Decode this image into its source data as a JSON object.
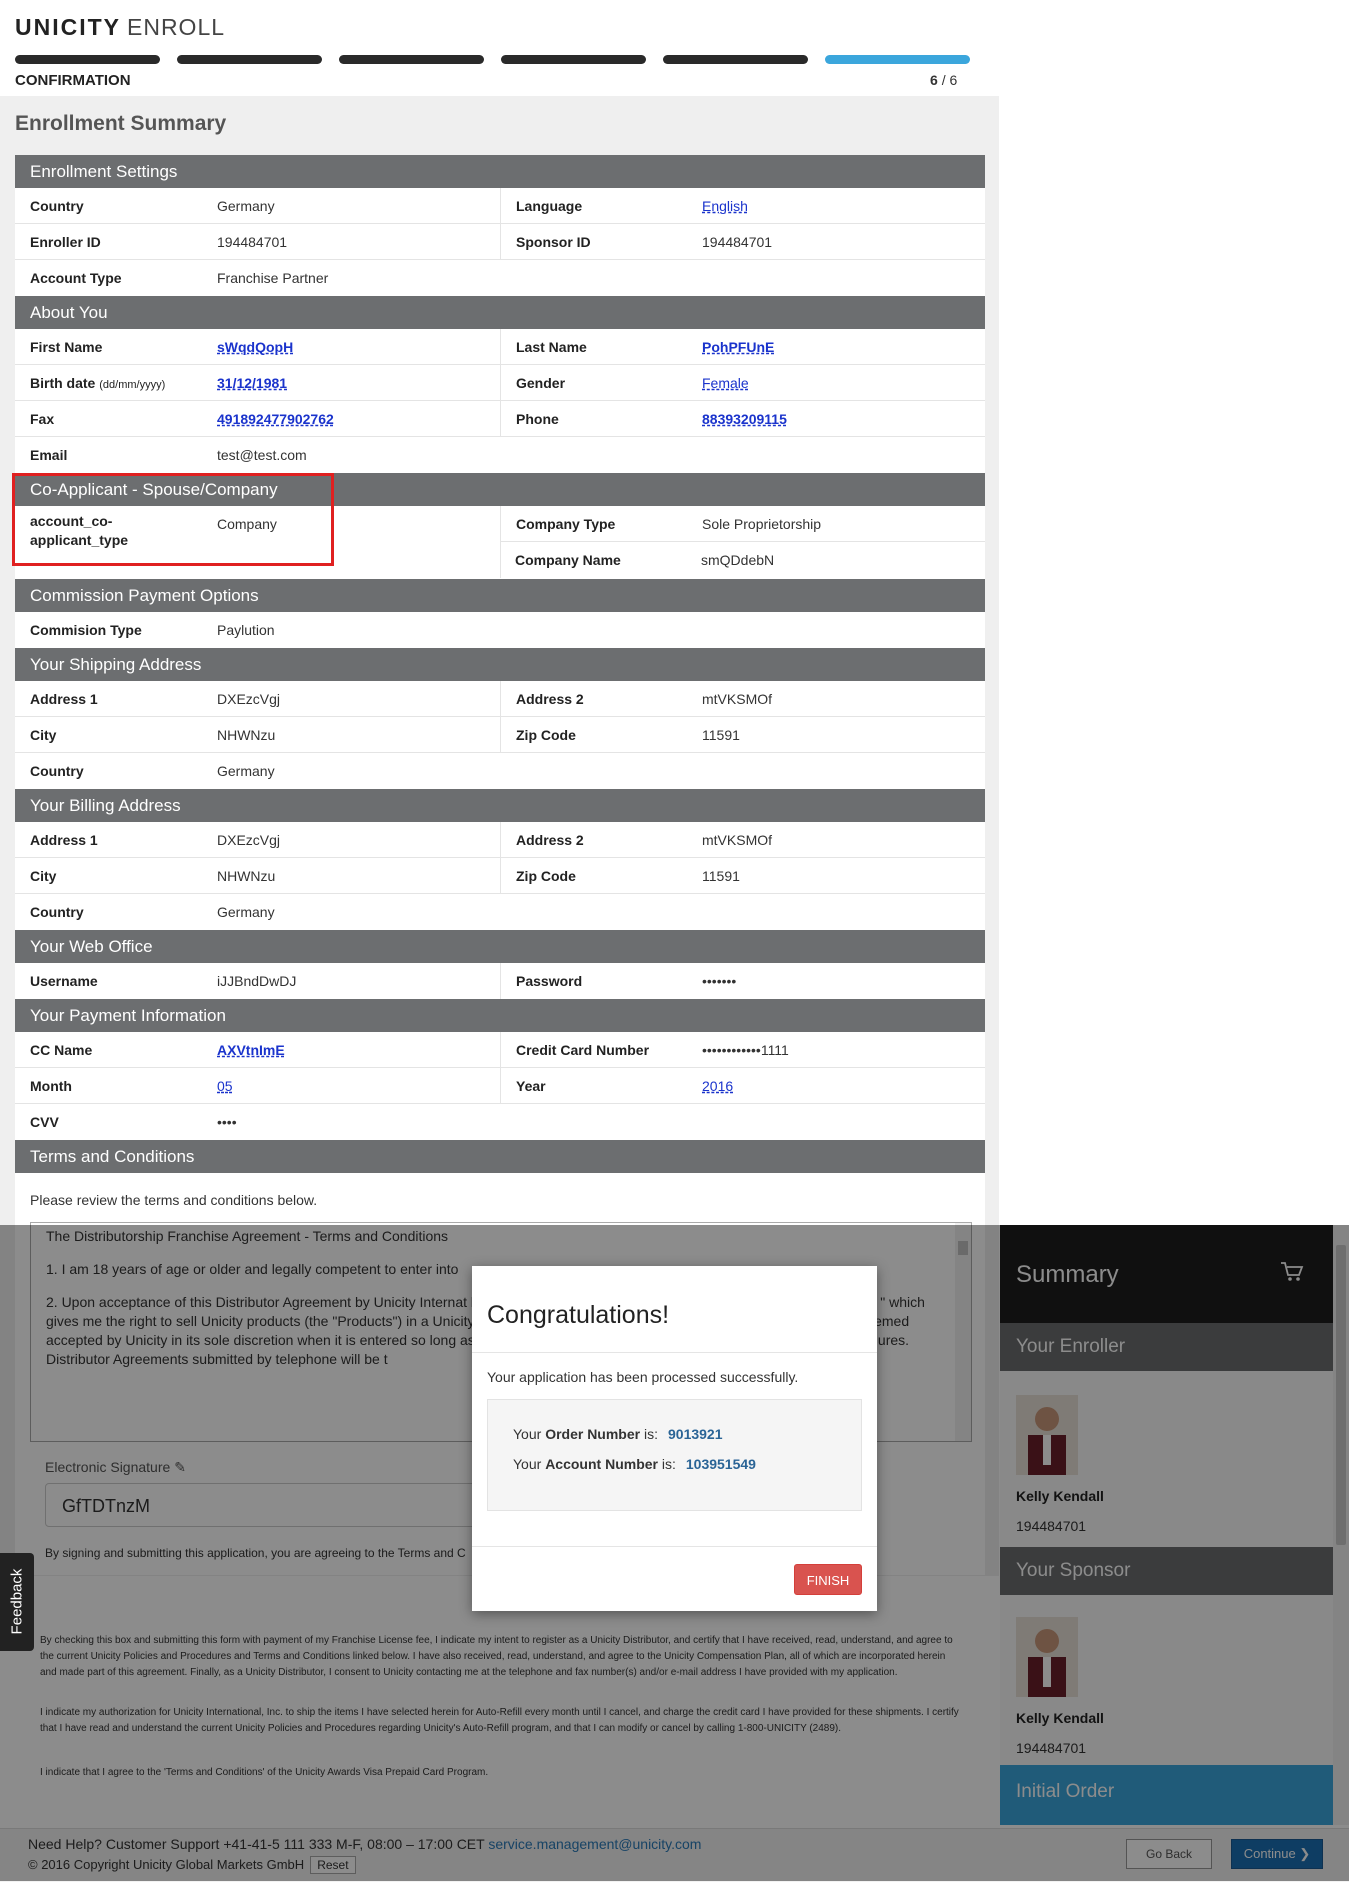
{
  "header": {
    "brand": "UNICITY",
    "product": "ENROLL",
    "step_label": "CONFIRMATION",
    "step_current": "6",
    "step_total": "/ 6",
    "progress": {
      "steps_total": 6,
      "current": 6
    }
  },
  "page_title": "Enrollment Summary",
  "sections": {
    "enrollment_settings": {
      "title": "Enrollment Settings",
      "country_label": "Country",
      "country": "Germany",
      "language_label": "Language",
      "language": "English",
      "enroller_label": "Enroller ID",
      "enroller": "194484701",
      "sponsor_label": "Sponsor ID",
      "sponsor": "194484701",
      "account_type_label": "Account Type",
      "account_type": "Franchise Partner"
    },
    "about_you": {
      "title": "About You",
      "first_name_label": "First Name",
      "first_name": "sWqdQopH",
      "last_name_label": "Last Name",
      "last_name": "PohPFUnE",
      "birth_label": "Birth date",
      "birth_hint": "(dd/mm/yyyy)",
      "birth": "31/12/1981",
      "gender_label": "Gender",
      "gender": "Female",
      "fax_label": "Fax",
      "fax": "491892477902762",
      "phone_label": "Phone",
      "phone": "88393209115",
      "email_label": "Email",
      "email": "test@test.com"
    },
    "co_applicant": {
      "title": "Co-Applicant - Spouse/Company",
      "type_label_1": "account_co-",
      "type_label_2": "applicant_type",
      "type": "Company",
      "company_type_label": "Company Type",
      "company_type": "Sole Proprietorship",
      "company_name_label": "Company Name",
      "company_name": "smQDdebN"
    },
    "commission": {
      "title": "Commission Payment Options",
      "type_label": "Commision Type",
      "type": "Paylution"
    },
    "shipping": {
      "title": "Your Shipping Address",
      "address1_label": "Address 1",
      "address1": "DXEzcVgj",
      "address2_label": "Address 2",
      "address2": "mtVKSMOf",
      "city_label": "City",
      "city": "NHWNzu",
      "zip_label": "Zip Code",
      "zip": "11591",
      "country_label": "Country",
      "country": "Germany"
    },
    "billing": {
      "title": "Your Billing Address",
      "address1_label": "Address 1",
      "address1": "DXEzcVgj",
      "address2_label": "Address 2",
      "address2": "mtVKSMOf",
      "city_label": "City",
      "city": "NHWNzu",
      "zip_label": "Zip Code",
      "zip": "11591",
      "country_label": "Country",
      "country": "Germany"
    },
    "web_office": {
      "title": "Your Web Office",
      "username_label": "Username",
      "username": "iJJBndDwDJ",
      "password_label": "Password",
      "password": "•••••••"
    },
    "payment": {
      "title": "Your Payment Information",
      "cc_name_label": "CC Name",
      "cc_name": "AXVtnImE",
      "cc_number_label": "Credit Card Number",
      "cc_number": "••••••••••••1111",
      "month_label": "Month",
      "month": "05",
      "year_label": "Year",
      "year": "2016",
      "cvv_label": "CVV",
      "cvv": "••••"
    },
    "terms": {
      "title": "Terms and Conditions",
      "intro": "Please review the terms and conditions below.",
      "p1": "The Distributorship Franchise Agreement - Terms and Conditions",
      "p2": "1. I am 18 years of age or older and legally competent to enter into",
      "p3": "2. Upon acceptance of this Distributor Agreement by Unicity Internat be an independent contractor and licensed distributor (hereinafter \" which gives me the right to sell Unicity products (the \"Products\") in a Unicity Compensation Plan (the \"Compensation Plan\"). This Distribu deemed accepted by Unicity in its sole discretion when it is entered so long as there have been no violations with respect to this applica Procedures. Distributor Agreements submitted by telephone will be t",
      "esig_label": "Electronic Signature",
      "esig_value": "GfTDTnzM",
      "sign_note": "By signing and submitting this application, you are agreeing to the Terms and C",
      "legal1": "By checking this box and submitting this form with payment of my Franchise License fee, I indicate my intent to register as a Unicity Distributor, and certify that I have received, read, understand, and agree to the current Unicity Policies and Procedures and Terms and Conditions linked below. I have also received, read, understand, and agree to the Unicity Compensation Plan, all of which are incorporated herein and made part of this agreement. Finally, as a Unicity Distributor, I consent to Unicity contacting me at the telephone and fax number(s) and/or e-mail address I have provided with my application.",
      "legal2": "I indicate my authorization for Unicity International, Inc. to ship the items I have selected herein for Auto-Refill every month until I cancel, and charge the credit card I have provided for these shipments. I certify that I have read and understand the current Unicity Policies and Procedures regarding Unicity's Auto-Refill program, and that I can modify or cancel by calling 1-800-UNICITY (2489).",
      "legal3": "I indicate that I agree to the 'Terms and Conditions' of the Unicity Awards Visa Prepaid Card Program."
    }
  },
  "sidebar": {
    "title": "Summary",
    "enroller_title": "Your Enroller",
    "enroller_name": "Kelly Kendall",
    "enroller_id": "194484701",
    "sponsor_title": "Your Sponsor",
    "sponsor_name": "Kelly Kendall",
    "sponsor_id": "194484701",
    "initial_order": "Initial Order"
  },
  "modal": {
    "title": "Congratulations!",
    "message": "Your application has been processed successfully.",
    "order_prefix": "Your ",
    "order_bold": "Order Number",
    "order_suffix": " is:",
    "order_number": "9013921",
    "account_prefix": "Your ",
    "account_bold": "Account Number",
    "account_suffix": " is:",
    "account_number": "103951549",
    "finish": "FINISH"
  },
  "footer": {
    "help": "Need Help? Customer Support +41-41-5 111 333 M-F, 08:00 – 17:00 CET ",
    "email": "service.management@unicity.com",
    "copyright": "© 2016 Copyright Unicity Global Markets GmbH",
    "reset": "Reset",
    "go_back": "Go Back",
    "continue": "Continue"
  },
  "feedback": "Feedback",
  "colors": {
    "accent": "#3ba6dc",
    "section_header": "#6c6e70",
    "danger": "#d9534f",
    "link": "#1a33cc"
  }
}
